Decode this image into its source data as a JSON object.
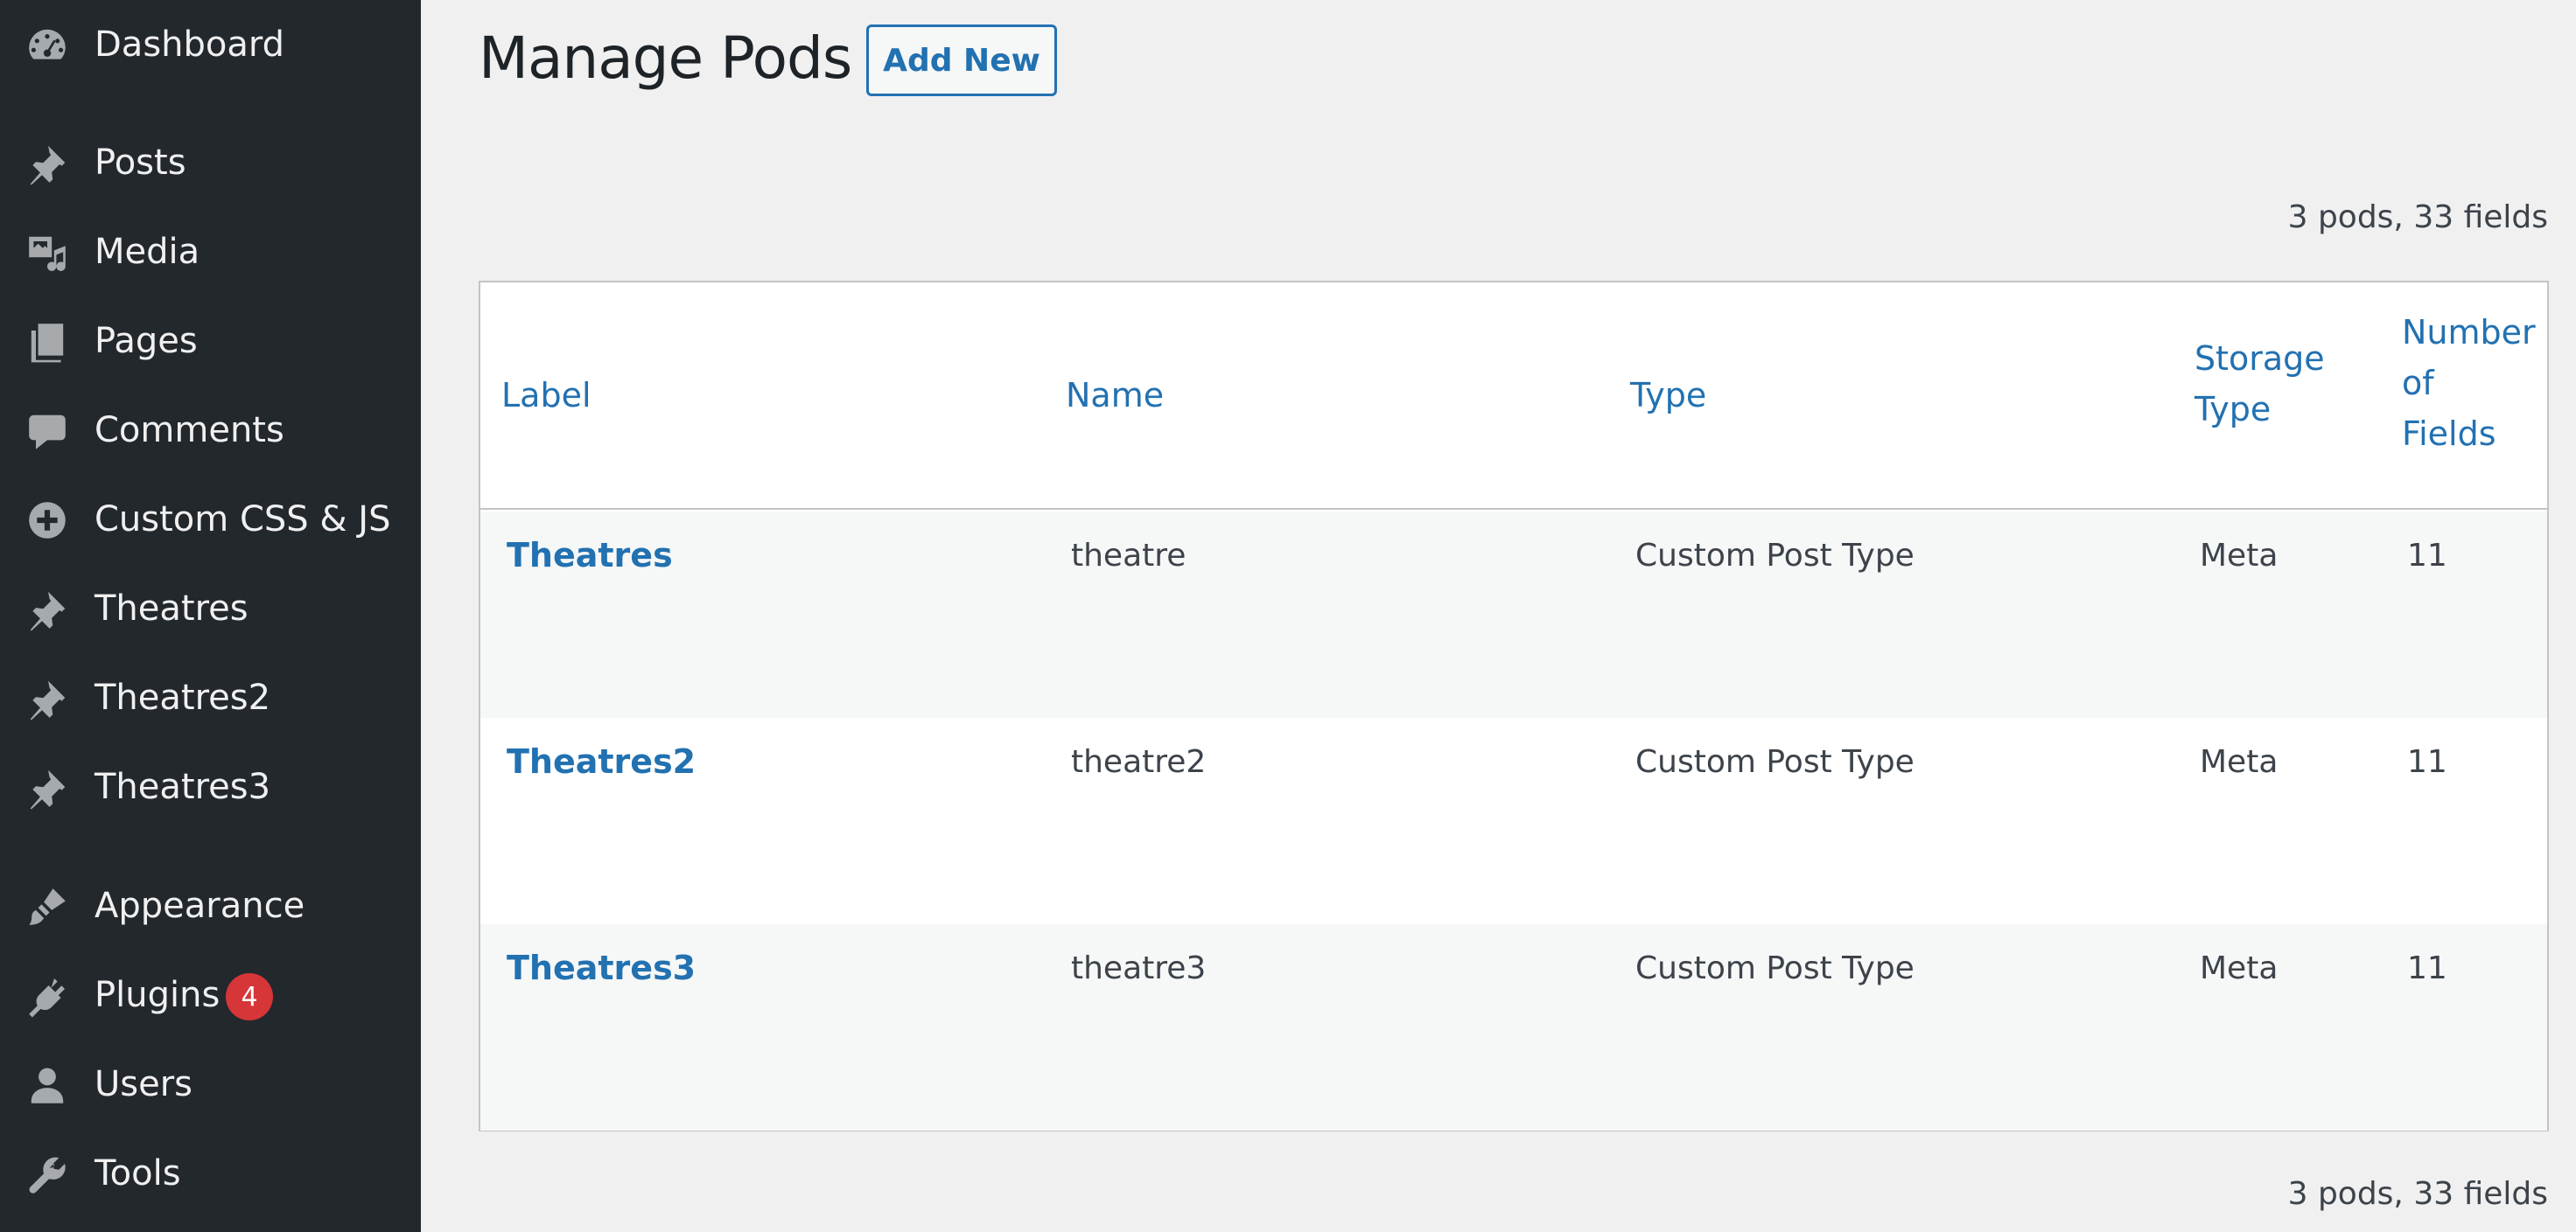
{
  "sidebar": {
    "items": [
      {
        "label": "Dashboard",
        "icon": "dashboard-icon"
      },
      {
        "label": "Posts",
        "icon": "pin-icon"
      },
      {
        "label": "Media",
        "icon": "media-icon"
      },
      {
        "label": "Pages",
        "icon": "pages-icon"
      },
      {
        "label": "Comments",
        "icon": "comment-icon"
      },
      {
        "label": "Custom CSS & JS",
        "icon": "plus-circle-icon"
      },
      {
        "label": "Theatres",
        "icon": "pin-icon"
      },
      {
        "label": "Theatres2",
        "icon": "pin-icon"
      },
      {
        "label": "Theatres3",
        "icon": "pin-icon"
      },
      {
        "label": "Appearance",
        "icon": "brush-icon"
      },
      {
        "label": "Plugins",
        "icon": "plugin-icon",
        "badge": "4"
      },
      {
        "label": "Users",
        "icon": "user-icon"
      },
      {
        "label": "Tools",
        "icon": "wrench-icon"
      }
    ]
  },
  "header": {
    "title": "Manage Pods",
    "add_new_label": "Add New"
  },
  "counts": {
    "top": "3 pods, 33 fields",
    "bottom": "3 pods, 33 fields"
  },
  "table": {
    "columns": {
      "label": "Label",
      "name": "Name",
      "type": "Type",
      "storage_line1": "Storage",
      "storage_line2": "Type",
      "fields_line1": "Number",
      "fields_line2": "of",
      "fields_line3": "Fields"
    },
    "rows": [
      {
        "label": "Theatres",
        "name": "theatre",
        "type": "Custom Post Type",
        "storage": "Meta",
        "fields": "11"
      },
      {
        "label": "Theatres2",
        "name": "theatre2",
        "type": "Custom Post Type",
        "storage": "Meta",
        "fields": "11"
      },
      {
        "label": "Theatres3",
        "name": "theatre3",
        "type": "Custom Post Type",
        "storage": "Meta",
        "fields": "11"
      }
    ]
  },
  "colors": {
    "sidebar_bg": "#23282d",
    "link": "#2271b1",
    "badge": "#d63638",
    "page_bg": "#f0f0f1"
  }
}
